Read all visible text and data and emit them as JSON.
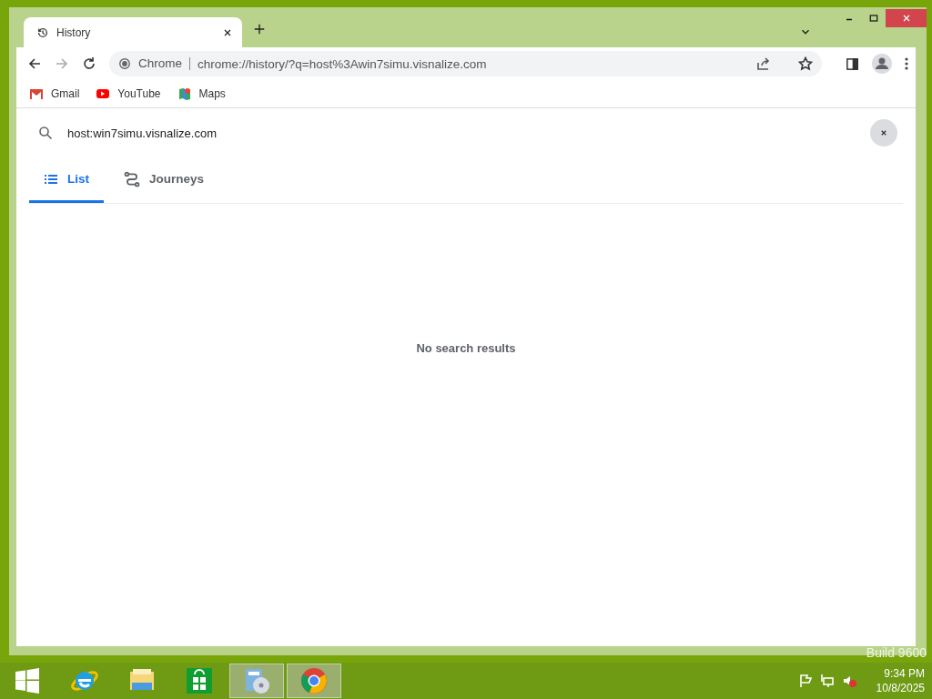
{
  "browser_tab": {
    "title": "History"
  },
  "address_bar": {
    "origin": "Chrome",
    "url": "chrome://history/?q=host%3Awin7simu.visnalize.com"
  },
  "bookmarks": [
    {
      "label": "Gmail",
      "kind": "gmail"
    },
    {
      "label": "YouTube",
      "kind": "youtube"
    },
    {
      "label": "Maps",
      "kind": "maps"
    }
  ],
  "search": {
    "value": "host:win7simu.visnalize.com"
  },
  "tabs": [
    {
      "label": "List",
      "kind": "list",
      "selected": true
    },
    {
      "label": "Journeys",
      "kind": "journeys",
      "selected": false
    }
  ],
  "empty_message": "No search results",
  "desktop_text": "Build 9600",
  "taskbar": {
    "items": [
      {
        "kind": "ie",
        "running": false
      },
      {
        "kind": "explorer",
        "running": false
      },
      {
        "kind": "store",
        "running": false
      },
      {
        "kind": "disc",
        "running": true
      },
      {
        "kind": "chrome",
        "running": true
      }
    ],
    "time": "9:34 PM",
    "date": "10/8/2025"
  }
}
